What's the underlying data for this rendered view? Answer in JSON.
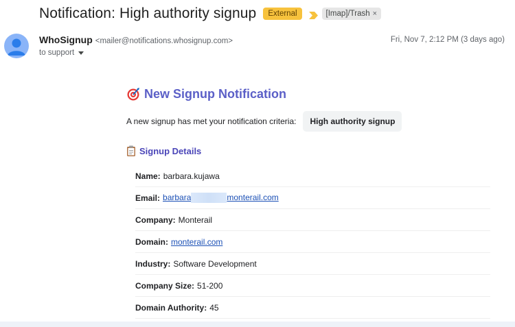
{
  "email": {
    "subject": "Notification: High authority signup",
    "badge_external": "External",
    "label": "[Imap]/Trash",
    "label_remove": "×",
    "sender": {
      "name": "WhoSignup",
      "address": "<mailer@notifications.whosignup.com>",
      "recipient": "to support"
    },
    "date": "Fri, Nov 7, 2:12 PM (3 days ago)"
  },
  "body": {
    "heading": "New Signup Notification",
    "criteria_text": "A new signup has met your notification criteria:",
    "criteria_value": "High authority signup",
    "section_title": "Signup Details",
    "fields": {
      "name": {
        "key": "Name:",
        "value": "barbara.kujawa"
      },
      "email": {
        "key": "Email:",
        "value_start": "barbara",
        "value_end": "monterail.com"
      },
      "company": {
        "key": "Company:",
        "value": "Monterail"
      },
      "domain": {
        "key": "Domain:",
        "value": "monterail.com"
      },
      "industry": {
        "key": "Industry:",
        "value": "Software Development"
      },
      "company_size": {
        "key": "Company Size:",
        "value": "51-200"
      },
      "domain_authority": {
        "key": "Domain Authority:",
        "value": "45"
      }
    }
  },
  "colors": {
    "heading": "#5b5fc7",
    "section_title": "#4a45b8",
    "external_badge": "#f7c23d",
    "link": "#1a4fb5",
    "avatar": "#8ab4f8"
  },
  "icons": {
    "heading_icon": "target-icon",
    "section_icon": "clipboard-icon",
    "importance": "importance-marker-icon",
    "avatar": "person-icon"
  }
}
